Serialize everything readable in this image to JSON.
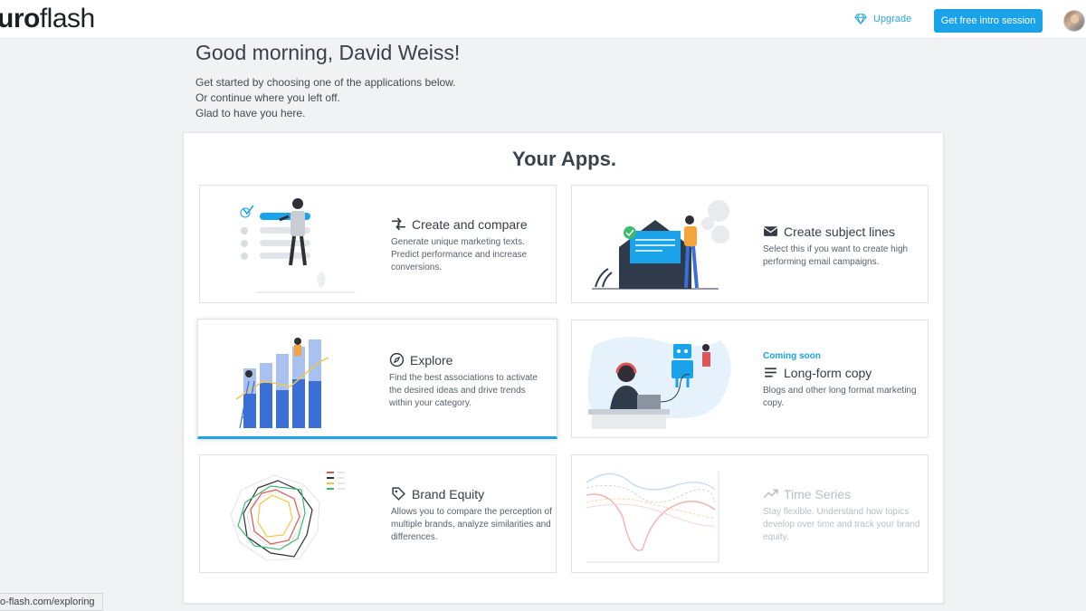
{
  "topbar": {
    "logo_bold": "uro",
    "logo_thin": "flash",
    "upgrade_label": "Upgrade",
    "cta_label": "Get free intro session"
  },
  "greeting": "Good morning, David Weiss!",
  "intro": [
    "Get started by choosing one of the applications below.",
    "Or continue where you left off.",
    "Glad to have you here."
  ],
  "apps": {
    "title": "Your Apps.",
    "cards": [
      {
        "title": "Create and compare",
        "desc": "Generate unique marketing texts. Predict performance and increase conversions.",
        "icon": "compare-arrows-icon"
      },
      {
        "title": "Create subject lines",
        "desc": "Select this if you want to create high performing email campaigns.",
        "icon": "envelope-icon"
      },
      {
        "title": "Explore",
        "desc": "Find the best associations to activate the desired ideas and drive trends within your category.",
        "icon": "compass-icon"
      },
      {
        "badge": "Coming soon",
        "title": "Long-form copy",
        "desc": "Blogs and other long format marketing copy.",
        "icon": "lines-icon"
      },
      {
        "title": "Brand Equity",
        "desc": "Allows you to compare the perception of multiple brands, analyze similarities and differences.",
        "icon": "tag-icon"
      },
      {
        "title": "Time Series",
        "desc": "Stay flexible. Understand how topics develop over time and track your brand equity.",
        "icon": "trend-icon"
      }
    ]
  },
  "status_url": "o-flash.com/exploring",
  "colors": {
    "accent": "#1aa3e8",
    "illustration_blue": "#3b6fd8",
    "illustration_dark": "#2f3a4a"
  }
}
